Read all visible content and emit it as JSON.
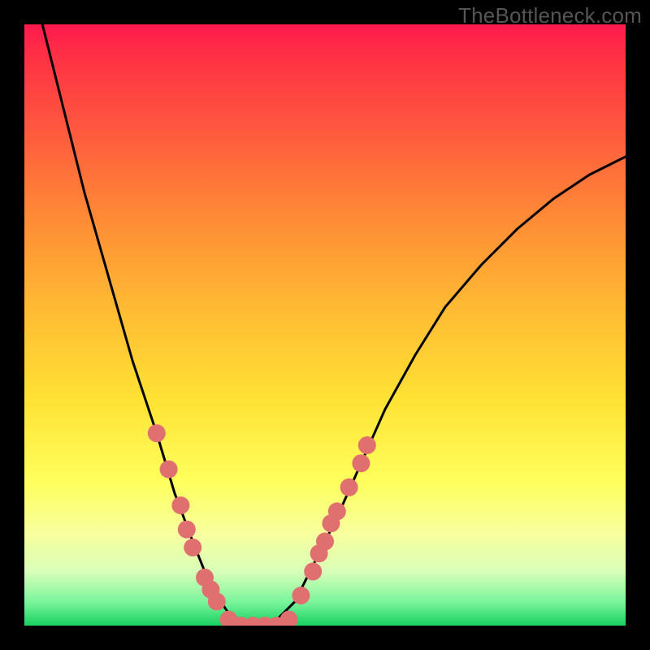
{
  "watermark": "TheBottleneck.com",
  "chart_data": {
    "type": "line",
    "title": "",
    "xlabel": "",
    "ylabel": "",
    "xlim": [
      0,
      100
    ],
    "ylim": [
      0,
      100
    ],
    "grid": false,
    "legend": false,
    "series": [
      {
        "name": "curve",
        "x": [
          3,
          6,
          10,
          14,
          18,
          22,
          25,
          28,
          30,
          32,
          34,
          36,
          38,
          40,
          42,
          45,
          48,
          52,
          56,
          60,
          65,
          70,
          76,
          82,
          88,
          94,
          100
        ],
        "y": [
          100,
          88,
          72,
          58,
          44,
          32,
          22,
          14,
          9,
          5,
          2,
          0,
          0,
          0,
          1,
          4,
          10,
          18,
          27,
          36,
          45,
          53,
          60,
          66,
          71,
          75,
          78
        ]
      }
    ],
    "marker_clusters": [
      {
        "name": "left-cluster",
        "color": "#e07070",
        "points": [
          {
            "x": 22,
            "y": 32
          },
          {
            "x": 24,
            "y": 26
          },
          {
            "x": 26,
            "y": 20
          },
          {
            "x": 27,
            "y": 16
          },
          {
            "x": 28,
            "y": 13
          },
          {
            "x": 30,
            "y": 8
          },
          {
            "x": 31,
            "y": 6
          },
          {
            "x": 32,
            "y": 4
          }
        ]
      },
      {
        "name": "bottom-cluster",
        "color": "#e07070",
        "points": [
          {
            "x": 34,
            "y": 1
          },
          {
            "x": 36,
            "y": 0
          },
          {
            "x": 38,
            "y": 0
          },
          {
            "x": 40,
            "y": 0
          },
          {
            "x": 42,
            "y": 0
          },
          {
            "x": 44,
            "y": 1
          }
        ]
      },
      {
        "name": "right-cluster",
        "color": "#e07070",
        "points": [
          {
            "x": 46,
            "y": 5
          },
          {
            "x": 48,
            "y": 9
          },
          {
            "x": 49,
            "y": 12
          },
          {
            "x": 50,
            "y": 14
          },
          {
            "x": 51,
            "y": 17
          },
          {
            "x": 52,
            "y": 19
          },
          {
            "x": 54,
            "y": 23
          },
          {
            "x": 56,
            "y": 27
          },
          {
            "x": 57,
            "y": 30
          }
        ]
      }
    ]
  }
}
